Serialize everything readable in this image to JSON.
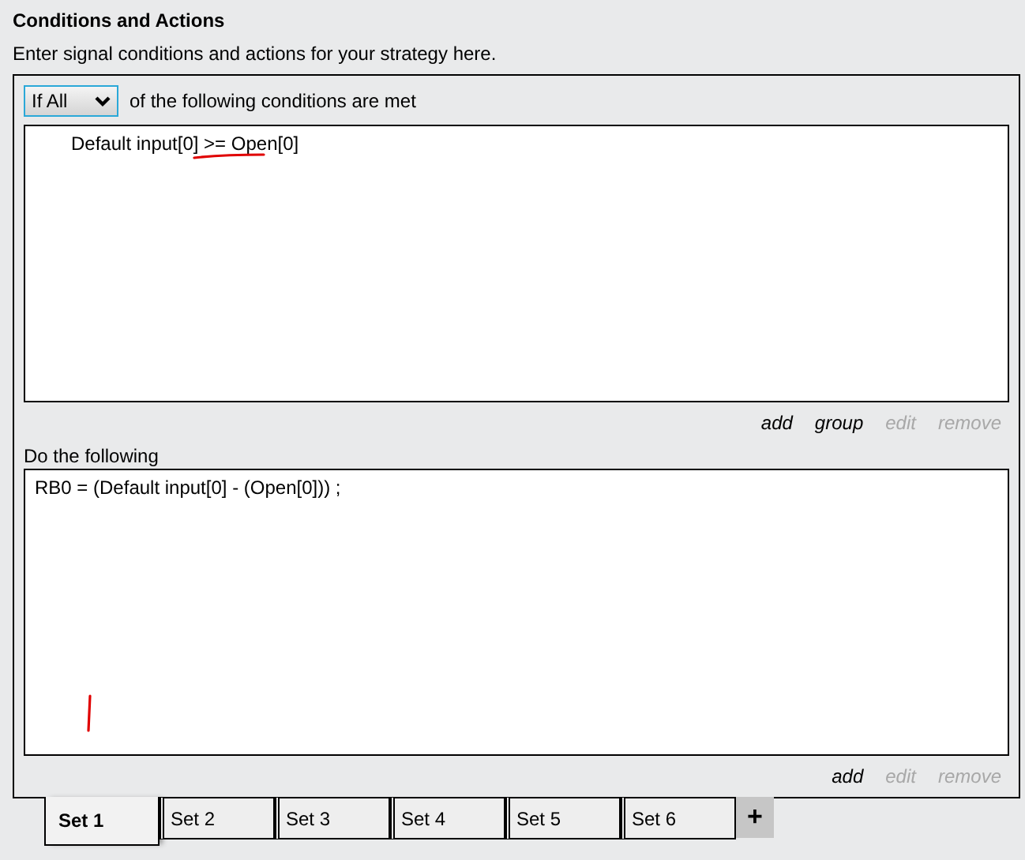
{
  "title": "Conditions and Actions",
  "description": "Enter signal conditions and actions for your strategy here.",
  "conditions": {
    "mode": "If All",
    "mode_suffix": "of the following conditions are met",
    "lines": [
      "Default input[0] >= Open[0]"
    ],
    "links": [
      {
        "label": "add",
        "disabled": false
      },
      {
        "label": "group",
        "disabled": false
      },
      {
        "label": "edit",
        "disabled": true
      },
      {
        "label": "remove",
        "disabled": true
      }
    ]
  },
  "actions": {
    "label": "Do the following",
    "lines": [
      "RB0 = (Default input[0] - (Open[0])) ;"
    ],
    "links": [
      {
        "label": "add",
        "disabled": false
      },
      {
        "label": "edit",
        "disabled": true
      },
      {
        "label": "remove",
        "disabled": true
      }
    ]
  },
  "tabs": [
    {
      "label": "Set 1",
      "selected": true
    },
    {
      "label": "Set 2",
      "selected": false
    },
    {
      "label": "Set 3",
      "selected": false
    },
    {
      "label": "Set 4",
      "selected": false
    },
    {
      "label": "Set 5",
      "selected": false
    },
    {
      "label": "Set 6",
      "selected": false
    }
  ],
  "add_tab": "+"
}
